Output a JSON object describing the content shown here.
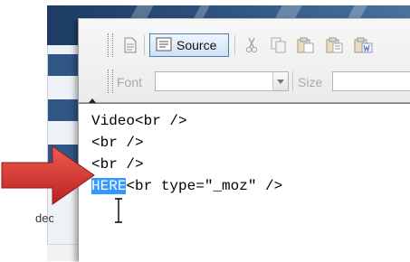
{
  "toolbar": {
    "source_label": "Source",
    "font_label": "Font",
    "size_label": "Size",
    "font_value": "",
    "size_value": ""
  },
  "editor": {
    "lines": [
      {
        "text": "Video<br />"
      },
      {
        "text": "<br />"
      },
      {
        "text": "<br />"
      },
      {
        "selected": "HERE",
        "rest": "<br type=\"_moz\" />"
      }
    ]
  },
  "background": {
    "side_label": "deo"
  },
  "colors": {
    "selection": "#3399ff",
    "arrow": "#d8332e",
    "banner": "#2c4f7c"
  },
  "icons": [
    "document-icon",
    "source-icon",
    "cut-icon",
    "copy-icon",
    "paste-icon",
    "paste-text-icon",
    "paste-word-icon",
    "arrow-indicator",
    "text-cursor-icon"
  ]
}
